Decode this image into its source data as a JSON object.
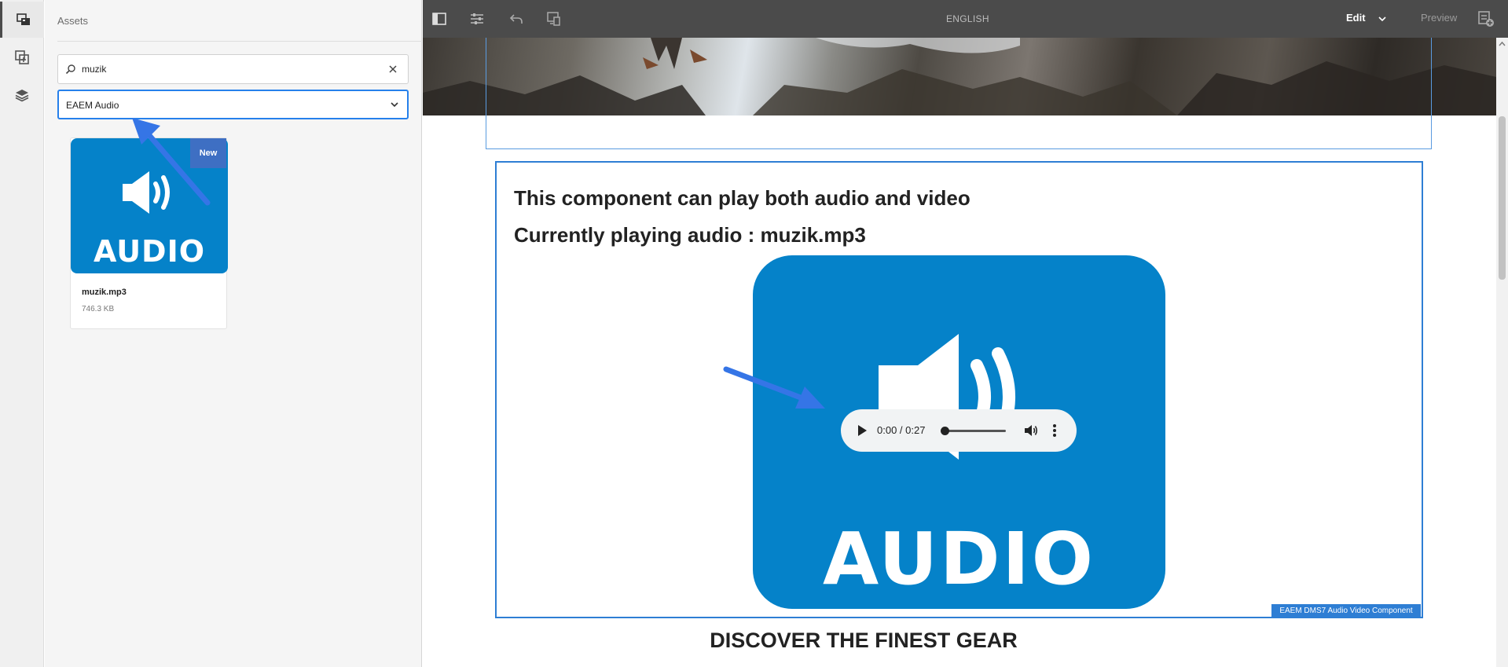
{
  "panel": {
    "title": "Assets",
    "search": {
      "value": "muzik",
      "placeholder": ""
    },
    "filter_select": {
      "selected": "EAEM Audio"
    },
    "asset_card": {
      "badge": "New",
      "thumb_word": "AUDIO",
      "name": "muzik.mp3",
      "size": "746.3 KB"
    }
  },
  "toolbar": {
    "language": "ENGLISH",
    "mode": "Edit",
    "preview": "Preview"
  },
  "page": {
    "heading1": "This component can play both audio and video",
    "heading2": "Currently playing audio : muzik.mp3",
    "media_word": "AUDIO",
    "player": {
      "time": "0:00 / 0:27",
      "progress": 0
    },
    "component_label": "EAEM DMS7 Audio Video Component",
    "next_heading": "DISCOVER THE FINEST GEAR"
  },
  "colors": {
    "accent_blue": "#2680eb",
    "audio_blue": "#0582c9",
    "badge_blue": "#3e6fc3",
    "toolbar": "#4b4b4b"
  },
  "icons": [
    "assets-icon",
    "components-icon",
    "layers-icon",
    "side-panel-toggle-icon",
    "page-properties-icon",
    "undo-icon",
    "emulator-icon",
    "search-icon",
    "clear-icon",
    "chevron-down-icon",
    "play-icon",
    "volume-icon",
    "more-options-icon",
    "annotate-icon"
  ]
}
